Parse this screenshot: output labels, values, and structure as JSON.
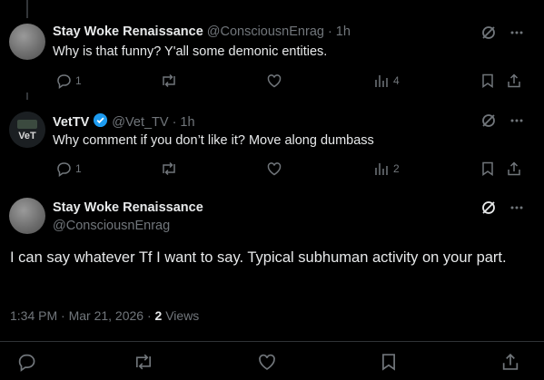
{
  "tweets": [
    {
      "name": "Stay Woke Renaissance",
      "handle": "@ConsciousnEnrag",
      "sep": "·",
      "time": "1h",
      "text": "Why is that funny? Y'all some demonic entities.",
      "replies": "1",
      "views": "4"
    },
    {
      "name": "VetTV",
      "handle": "@Vet_TV",
      "sep": "·",
      "time": "1h",
      "text": "Why comment if you don’t like it? Move along dumbass",
      "replies": "1",
      "views": "2",
      "avatar_text": "VeT"
    }
  ],
  "main": {
    "name": "Stay Woke Renaissance",
    "handle": "@ConsciousnEnrag",
    "text": "I can say whatever Tf I want to say. Typical subhuman activity on your part.",
    "time_date": "1:34 PM · Mar 21, 2026 · ",
    "views_count": "2",
    "views_label": " Views"
  },
  "colors": {
    "background": "#000000",
    "text": "#e7e9ea",
    "muted": "#71767b",
    "divider": "#2f3336",
    "verified": "#1d9bf0"
  },
  "icons": [
    "grok-icon",
    "more-icon",
    "reply-icon",
    "retweet-icon",
    "like-icon",
    "views-icon",
    "bookmark-icon",
    "share-icon",
    "verified-badge-icon"
  ]
}
